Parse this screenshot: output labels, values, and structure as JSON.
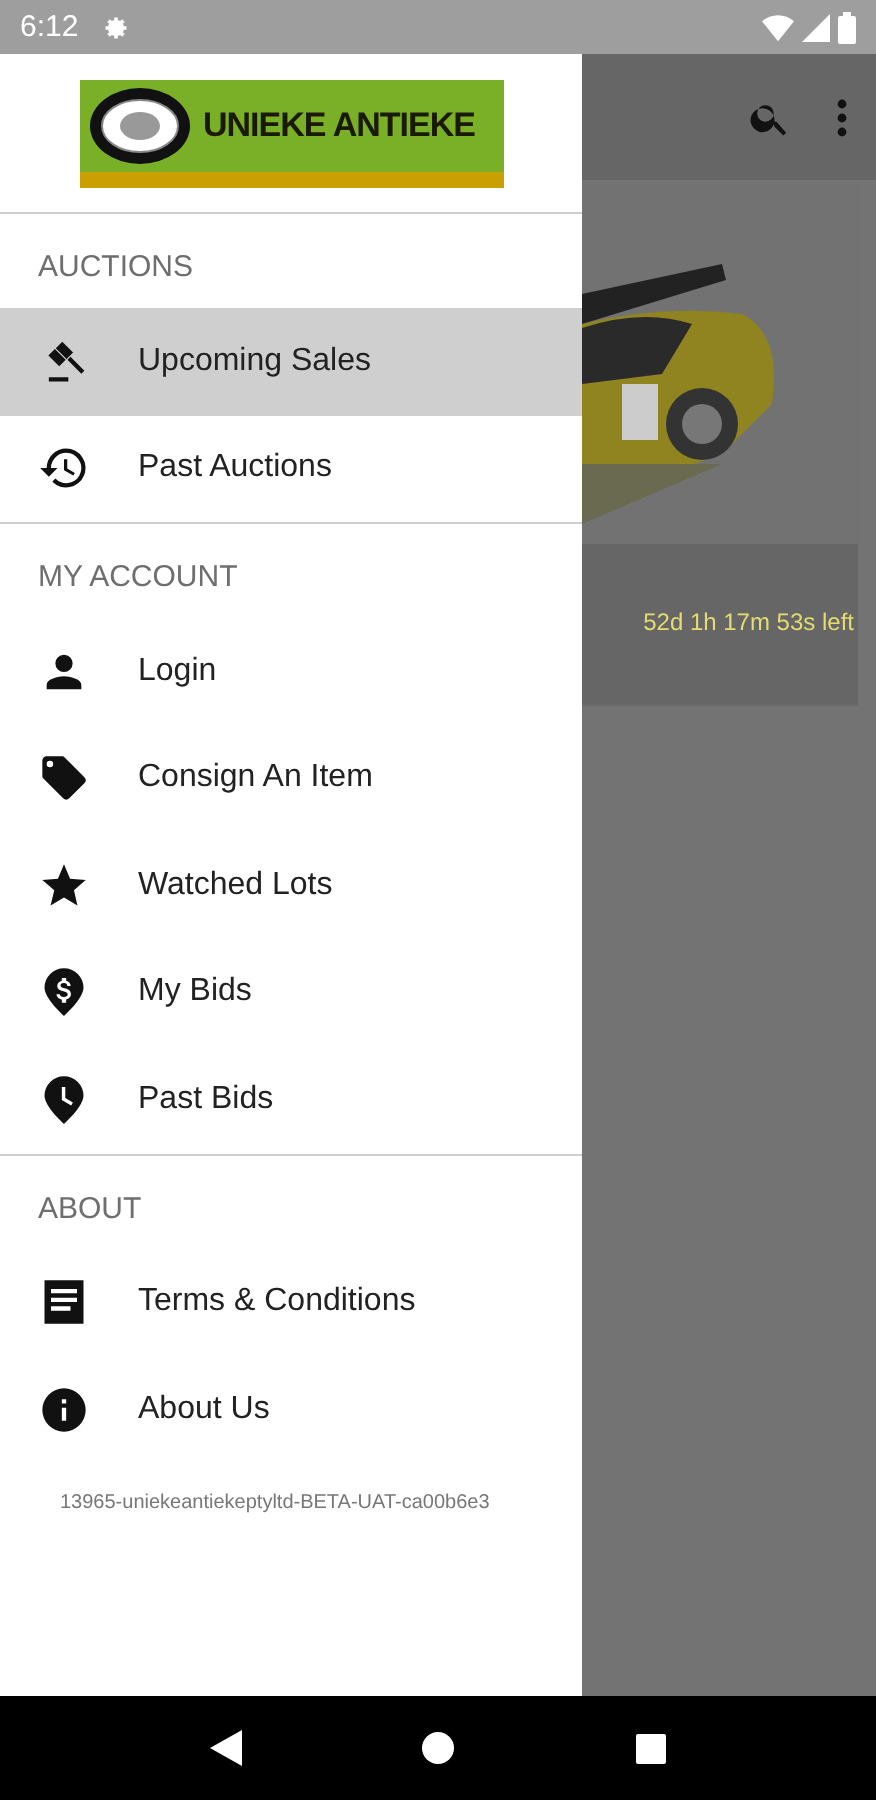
{
  "status_bar": {
    "time": "6:12"
  },
  "drawer": {
    "logo": {
      "title": "UNIEKE ANTIEKE"
    },
    "sections": [
      {
        "heading": "AUCTIONS",
        "items": [
          {
            "label": "Upcoming Sales",
            "kind": "gavel",
            "selected": true
          },
          {
            "label": "Past Auctions",
            "kind": "history",
            "selected": false
          }
        ]
      },
      {
        "heading": "MY ACCOUNT",
        "items": [
          {
            "label": "Login",
            "kind": "person",
            "selected": false
          },
          {
            "label": "Consign An Item",
            "kind": "tag",
            "selected": false
          },
          {
            "label": "Watched Lots",
            "kind": "star",
            "selected": false
          },
          {
            "label": "My Bids",
            "kind": "dollar",
            "selected": false
          },
          {
            "label": "Past Bids",
            "kind": "clock",
            "selected": false
          }
        ]
      },
      {
        "heading": "ABOUT",
        "items": [
          {
            "label": "Terms & Conditions",
            "kind": "document",
            "selected": false
          },
          {
            "label": "About Us",
            "kind": "info",
            "selected": false
          }
        ]
      }
    ],
    "version": "13965-uniekeantiekeptyltd-BETA-UAT-ca00b6e3"
  },
  "background": {
    "lot": {
      "time_left": "52d 1h 17m 53s left"
    }
  }
}
